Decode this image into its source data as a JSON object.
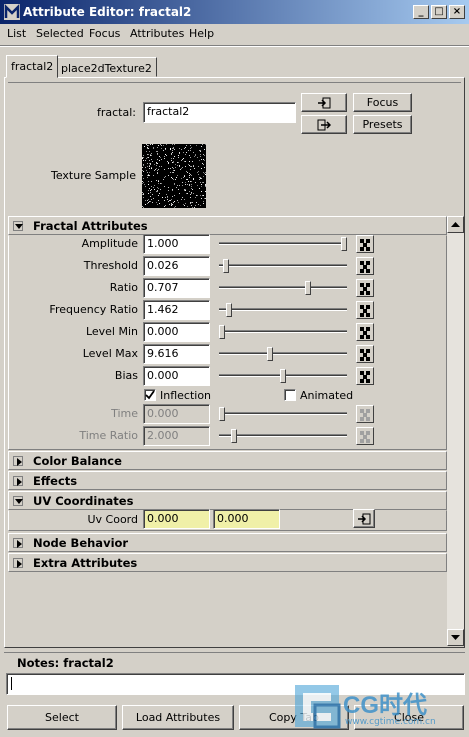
{
  "window": {
    "title": "Attribute Editor: fractal2"
  },
  "menu": [
    "List",
    "Selected",
    "Focus",
    "Attributes",
    "Help"
  ],
  "tabs": [
    "fractal2",
    "place2dTexture2"
  ],
  "header": {
    "node_label": "fractal:",
    "node_value": "fractal2",
    "focus_label": "Focus",
    "presets_label": "Presets",
    "texture_sample_label": "Texture Sample"
  },
  "sections": {
    "fractal": "Fractal Attributes",
    "color_balance": "Color Balance",
    "effects": "Effects",
    "uv": "UV Coordinates",
    "node_behavior": "Node Behavior",
    "extra": "Extra Attributes"
  },
  "fractal_attrs": [
    {
      "label": "Amplitude",
      "value": "1.000",
      "slider": 1.0,
      "enabled": true
    },
    {
      "label": "Threshold",
      "value": "0.026",
      "slider": 0.03,
      "enabled": true
    },
    {
      "label": "Ratio",
      "value": "0.707",
      "slider": 0.707,
      "enabled": true
    },
    {
      "label": "Frequency Ratio",
      "value": "1.462",
      "slider": 0.06,
      "enabled": true
    },
    {
      "label": "Level Min",
      "value": "0.000",
      "slider": 0.0,
      "enabled": true
    },
    {
      "label": "Level Max",
      "value": "9.616",
      "slider": 0.39,
      "enabled": true
    },
    {
      "label": "Bias",
      "value": "0.000",
      "slider": 0.5,
      "enabled": true
    }
  ],
  "checkboxes": {
    "inflection_label": "Inflection",
    "inflection_checked": true,
    "animated_label": "Animated",
    "animated_checked": false
  },
  "time_attrs": [
    {
      "label": "Time",
      "value": "0.000",
      "slider": 0.0,
      "enabled": false
    },
    {
      "label": "Time Ratio",
      "value": "2.000",
      "slider": 0.1,
      "enabled": false
    }
  ],
  "uv": {
    "label": "Uv Coord",
    "u": "0.000",
    "v": "0.000"
  },
  "notes": {
    "label": "Notes: fractal2",
    "value": ""
  },
  "bottom_buttons": [
    "Select",
    "Load Attributes",
    "Copy Tab",
    "Close"
  ],
  "watermark": {
    "logo_text": "CG时代",
    "url": "www.cgtime.com.cn"
  }
}
